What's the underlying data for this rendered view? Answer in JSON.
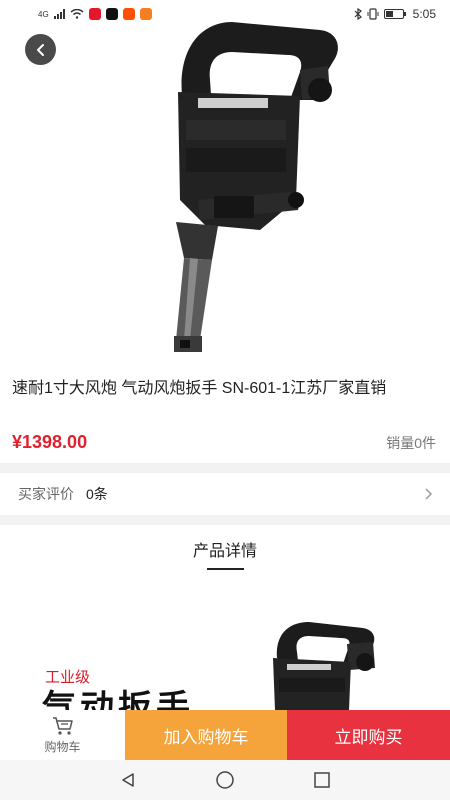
{
  "status_bar": {
    "network": "4G",
    "time": "5:05",
    "icons": [
      "signal-icon",
      "wifi-icon",
      "app-weibo-icon",
      "app-tiktok-icon",
      "app-taobao-icon",
      "app-shop-icon",
      "bluetooth-icon",
      "vibrate-icon",
      "battery-icon"
    ]
  },
  "product": {
    "title": "速耐1寸大风炮 气动风炮扳手 SN-601-1江苏厂家直销",
    "price": "¥1398.00",
    "sales": "销量0件"
  },
  "reviews": {
    "label": "买家评价",
    "count": "0条"
  },
  "details": {
    "heading": "产品详情",
    "image_tag": "工业级",
    "image_title": "气动扳手"
  },
  "bottom_bar": {
    "cart_label": "购物车",
    "add_to_cart": "加入购物车",
    "buy_now": "立即购买"
  },
  "colors": {
    "price_red": "#e0222f",
    "add_cart_orange": "#f5a33b",
    "buy_now_red": "#e8323f"
  }
}
